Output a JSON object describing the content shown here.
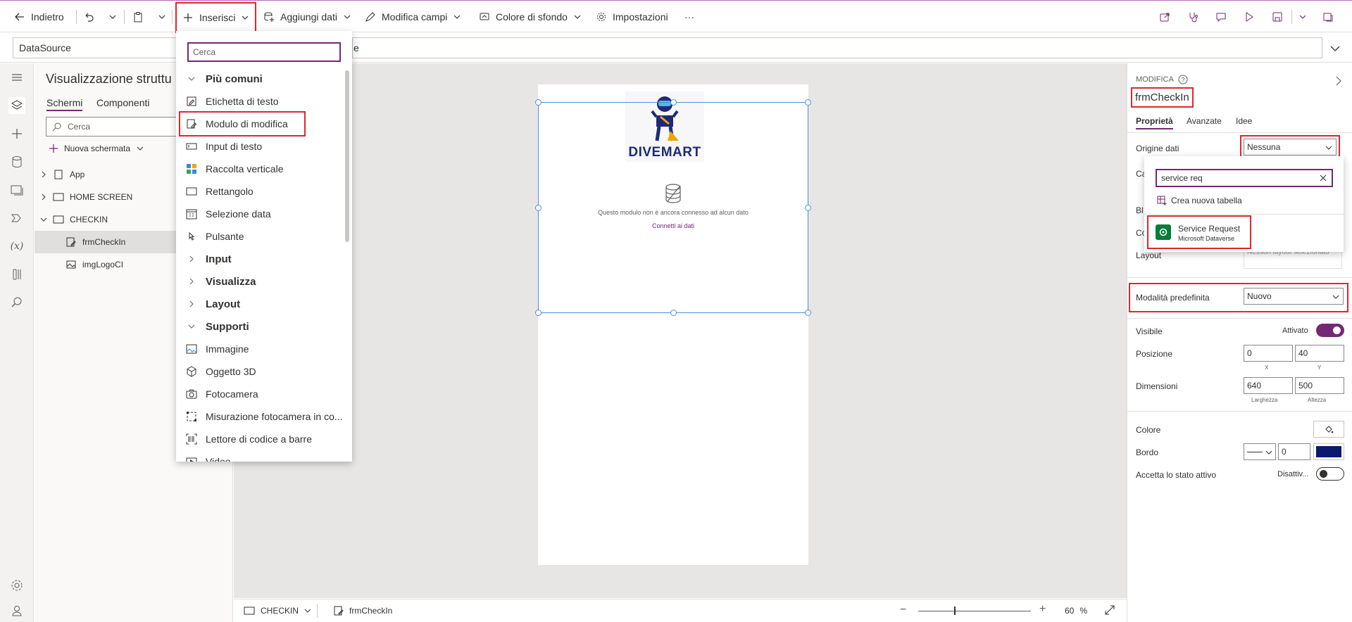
{
  "toolbar": {
    "back_label": "Indietro",
    "insert_label": "Inserisci",
    "add_data_label": "Aggiungi dati",
    "edit_fields_label": "Modifica campi",
    "bg_color_label": "Colore di sfondo",
    "settings_label": "Impostazioni",
    "more_label": "···"
  },
  "formula": {
    "property": "DataSource",
    "partial_text": "e"
  },
  "tree": {
    "title": "Visualizzazione struttu",
    "tabs": [
      "Schermi",
      "Componenti"
    ],
    "search_placeholder": "Cerca",
    "new_screen_label": "Nuova schermata",
    "items": [
      {
        "label": "App"
      },
      {
        "label": "HOME SCREEN"
      },
      {
        "label": "CHECKIN"
      },
      {
        "label": "frmCheckIn"
      },
      {
        "label": "imgLogoCI"
      }
    ]
  },
  "insert_menu": {
    "search_placeholder": "Cerca",
    "categories": {
      "common": "Più comuni",
      "input": "Input",
      "display": "Visualizza",
      "layout": "Layout",
      "media": "Supporti"
    },
    "common_items": [
      "Etichetta di testo",
      "Modulo di modifica",
      "Input di testo",
      "Raccolta verticale",
      "Rettangolo",
      "Selezione data",
      "Pulsante"
    ],
    "media_items": [
      "Immagine",
      "Oggetto 3D",
      "Fotocamera",
      "Misurazione fotocamera in co...",
      "Lettore di codice a barre",
      "Video"
    ]
  },
  "canvas": {
    "logo_text": "DIVEMART",
    "empty_message": "Questo modulo non è ancora connesso ad alcun dato",
    "connect_link": "Connetti ai dati"
  },
  "status": {
    "screen_name": "CHECKIN",
    "control_name": "frmCheckIn",
    "zoom_minus": "−",
    "zoom_plus": "+",
    "zoom_value": "60",
    "zoom_unit": "%",
    "zoom_level": 0.6
  },
  "rightpane": {
    "section_label": "MODIFICA",
    "control_name": "frmCheckIn",
    "tabs": [
      "Proprietà",
      "Avanzate",
      "Idee"
    ],
    "datasource_label": "Origine dati",
    "datasource_value": "Nessuna",
    "partial_label_c": "Ca",
    "partial_label_bl": "Bl",
    "partial_label_co": "Co",
    "layout_label": "Layout",
    "layout_placeholder": "Nessun layout selezionato",
    "default_mode_label": "Modalità predefinita",
    "default_mode_value": "Nuovo",
    "visible_label": "Visibile",
    "visible_value": "Attivato",
    "position_label": "Posizione",
    "pos_x": "0",
    "pos_y": "40",
    "pos_x_caption": "X",
    "pos_y_caption": "Y",
    "size_label": "Dimensioni",
    "width_value": "640",
    "height_value": "500",
    "width_caption": "Larghezza",
    "height_caption": "Altezza",
    "color_label": "Colore",
    "border_label": "Bordo",
    "border_width": "0",
    "border_color": "#0a1a6e",
    "focus_label": "Accetta lo stato attivo",
    "focus_value": "Disattiv..."
  },
  "ds_popup": {
    "search_value": "service req",
    "create_table_label": "Crea nuova tabella",
    "result_title": "Service Request",
    "result_subtitle": "Microsoft Dataverse"
  },
  "colors": {
    "accent": "#742774",
    "highlight_red": "#e0262c",
    "selection_blue": "#4a90d9"
  }
}
